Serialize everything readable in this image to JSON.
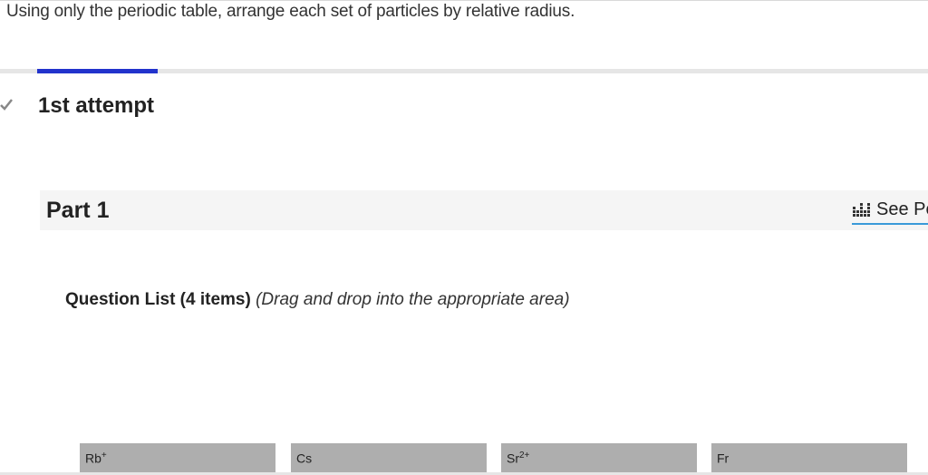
{
  "instruction": "Using only the periodic table, arrange each set of particles by relative radius.",
  "attempt": {
    "title": "1st attempt"
  },
  "part": {
    "title": "Part 1",
    "see_periodic_label": "See Pe"
  },
  "question_list": {
    "title": "Question List (4 items)",
    "hint": "(Drag and drop into the appropriate area)"
  },
  "items": [
    {
      "symbol": "Rb",
      "charge": "+"
    },
    {
      "symbol": "Cs",
      "charge": ""
    },
    {
      "symbol": "Sr",
      "charge": "2+"
    },
    {
      "symbol": "Fr",
      "charge": ""
    }
  ],
  "colors": {
    "accent": "#2233cc",
    "underline": "#3a9ad9",
    "item_bg": "#aeaeae"
  }
}
